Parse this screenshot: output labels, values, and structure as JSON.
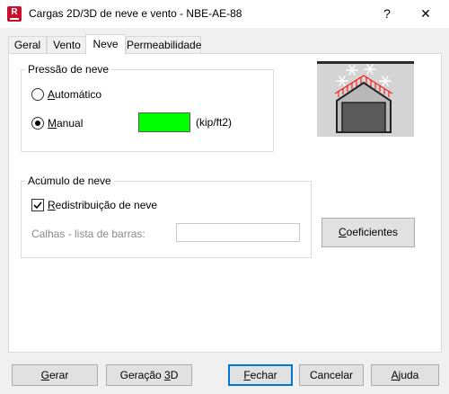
{
  "window": {
    "title": "Cargas 2D/3D de neve e vento - NBE-AE-88",
    "icon_letter": "R",
    "help_glyph": "?",
    "close_glyph": "✕"
  },
  "tabs": [
    {
      "label": "Geral"
    },
    {
      "label": "Vento"
    },
    {
      "label": "Neve",
      "active": true
    },
    {
      "label": "Permeabilidade"
    }
  ],
  "snow_pressure": {
    "group_label": "Pressão de neve",
    "auto_label": "Automático",
    "manual_label": "Manual",
    "selected": "Manual",
    "value_color": "#00ff00",
    "unit": "(kip/ft2)"
  },
  "accumulation": {
    "group_label": "Acúmulo de neve",
    "redistribution_label": "Redistribuição de neve",
    "redistribution_checked": true,
    "gutters_label": "Calhas - lista de barras:",
    "gutters_value": "",
    "coefficients_button": "Coeficientes"
  },
  "buttons": {
    "generate": "Gerar",
    "generate3d": "Geração 3D",
    "close": "Fechar",
    "cancel": "Cancelar",
    "help": "Ajuda"
  },
  "colors": {
    "brand": "#c8102e",
    "accent": "#0078d7",
    "snow_load": "#ff0000"
  }
}
